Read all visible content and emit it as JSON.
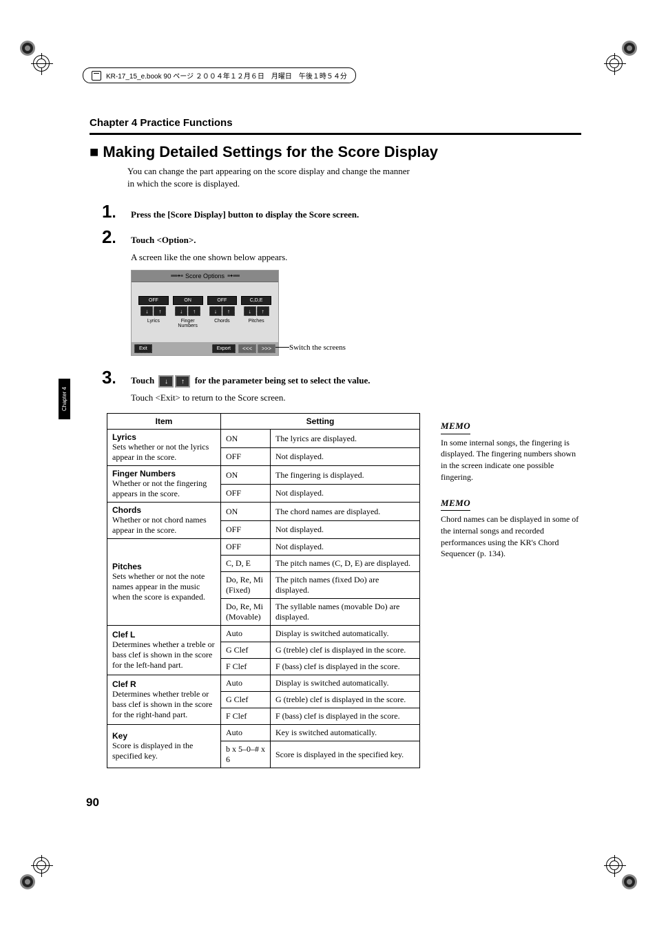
{
  "print_header": "KR-17_15_e.book  90 ページ  ２００４年１２月６日　月曜日　午後１時５４分",
  "chapter_header": "Chapter 4 Practice Functions",
  "section_title": "■ Making Detailed Settings for the Score Display",
  "intro_text": "You can change the part appearing on the score display and change the manner in which the score is displayed.",
  "steps": {
    "s1": {
      "num": "1",
      "text": "Press the [Score Display] button to display the Score screen."
    },
    "s2": {
      "num": "2",
      "text": "Touch <Option>.",
      "sub": "A screen like the one shown below appears."
    },
    "s3": {
      "num": "3",
      "pre": "Touch ",
      "post": " for the parameter being set to select the value.",
      "sub": "Touch <Exit> to return to the Score screen."
    }
  },
  "screenshot": {
    "title": "Score Options",
    "row_values": {
      "c1": "OFF",
      "c2": "ON",
      "c3": "OFF",
      "c4": "C,D,E"
    },
    "labels": {
      "l1": "Lyrics",
      "l2": "Finger Numbers",
      "l3": "Chords",
      "l4": "Pitches"
    },
    "exit": "Exit",
    "export": "Export",
    "left": "<<<",
    "right": ">>>",
    "down": "↓",
    "up": "↑"
  },
  "switch_label": "Switch the screens",
  "table_headers": {
    "item": "Item",
    "setting": "Setting"
  },
  "table": [
    {
      "name": "Lyrics",
      "desc": "Sets whether or not the lyrics appear in the score.",
      "rows": [
        {
          "val": "ON",
          "txt": "The lyrics are displayed."
        },
        {
          "val": "OFF",
          "txt": "Not displayed."
        }
      ]
    },
    {
      "name": "Finger Numbers",
      "desc": "Whether or not the fingering appears in the score.",
      "rows": [
        {
          "val": "ON",
          "txt": "The fingering is displayed."
        },
        {
          "val": "OFF",
          "txt": "Not displayed."
        }
      ]
    },
    {
      "name": "Chords",
      "desc": "Whether or not chord names appear in the score.",
      "rows": [
        {
          "val": "ON",
          "txt": "The chord names are displayed."
        },
        {
          "val": "OFF",
          "txt": "Not displayed."
        }
      ]
    },
    {
      "name": "Pitches",
      "desc": "Sets whether or not the note names appear in the music when the score is expanded.",
      "rows": [
        {
          "val": "OFF",
          "txt": "Not displayed."
        },
        {
          "val": "C, D, E",
          "txt": "The pitch names (C, D, E) are displayed."
        },
        {
          "val": "Do, Re, Mi (Fixed)",
          "txt": "The pitch names (fixed Do) are displayed."
        },
        {
          "val": "Do, Re, Mi (Movable)",
          "txt": "The syllable names (movable Do) are displayed."
        }
      ]
    },
    {
      "name": "Clef L",
      "desc": "Determines whether a treble or bass clef is shown in the score for the left-hand part.",
      "rows": [
        {
          "val": "Auto",
          "txt": "Display is switched automatically."
        },
        {
          "val": "G Clef",
          "txt": "G (treble) clef is displayed in the score."
        },
        {
          "val": "F Clef",
          "txt": "F (bass) clef is displayed in the score."
        }
      ]
    },
    {
      "name": "Clef R",
      "desc": "Determines whether treble or bass clef is shown in the score for the right-hand part.",
      "rows": [
        {
          "val": "Auto",
          "txt": "Display is switched automatically."
        },
        {
          "val": "G Clef",
          "txt": "G (treble) clef is displayed in the score."
        },
        {
          "val": "F Clef",
          "txt": "F (bass) clef is displayed in the score."
        }
      ]
    },
    {
      "name": "Key",
      "desc": "Score is displayed in the specified key.",
      "rows": [
        {
          "val": "Auto",
          "txt": "Key is switched automatically."
        },
        {
          "val": "b x 5–0–# x 6",
          "txt": "Score is displayed in the specified key."
        }
      ]
    }
  ],
  "memos": {
    "label": "MEMO",
    "m1": "In some internal songs, the fingering is displayed. The fingering numbers shown in the screen indicate one possible fingering.",
    "m2": "Chord names can be displayed in some of the internal songs and recorded performances using the KR's Chord Sequencer (p. 134)."
  },
  "side_tab": "Chapter 4",
  "page_number": "90"
}
